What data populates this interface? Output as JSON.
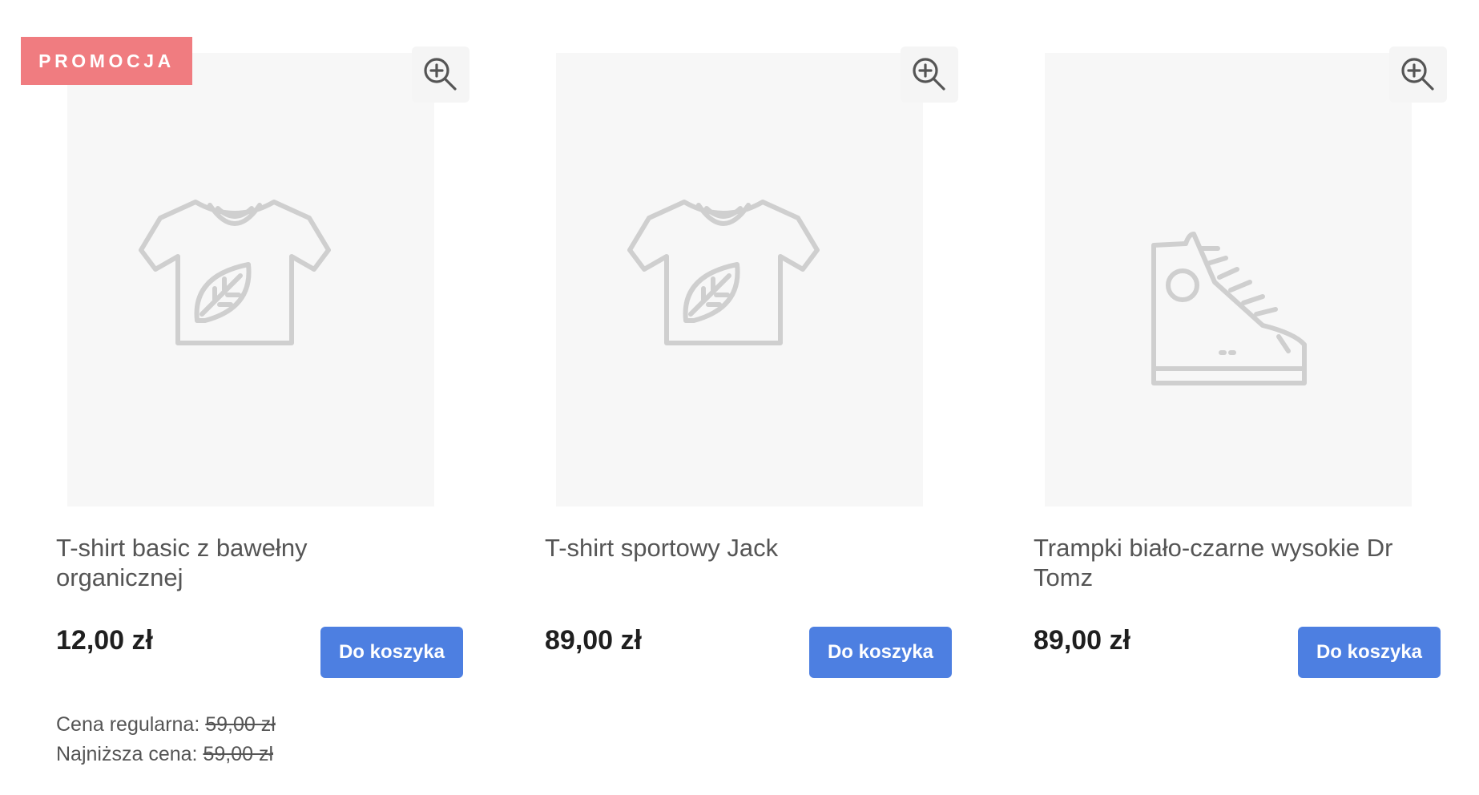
{
  "products": [
    {
      "badge": "PROMOCJA",
      "image_icon": "tshirt-leaf-icon",
      "title": "T-shirt basic z bawełny organicznej",
      "price": "12,00 zł",
      "cart_label": "Do koszyka",
      "regular_price_label": "Cena regularna:",
      "regular_price": "59,00 zł",
      "lowest_price_label": "Najniższa cena:",
      "lowest_price": "59,00 zł"
    },
    {
      "image_icon": "tshirt-leaf-icon",
      "title": "T-shirt sportowy Jack",
      "price": "89,00 zł",
      "cart_label": "Do koszyka"
    },
    {
      "image_icon": "sneaker-icon",
      "title": "Trampki biało-czarne wysokie Dr Tomz",
      "price": "89,00 zł",
      "cart_label": "Do koszyka"
    }
  ],
  "icons": {
    "zoom": "zoom-in-icon"
  },
  "colors": {
    "promo_badge": "#f07c80",
    "cart_button": "#4d7fe1",
    "image_placeholder": "#f7f7f7",
    "icon_stroke": "#cccccc"
  }
}
